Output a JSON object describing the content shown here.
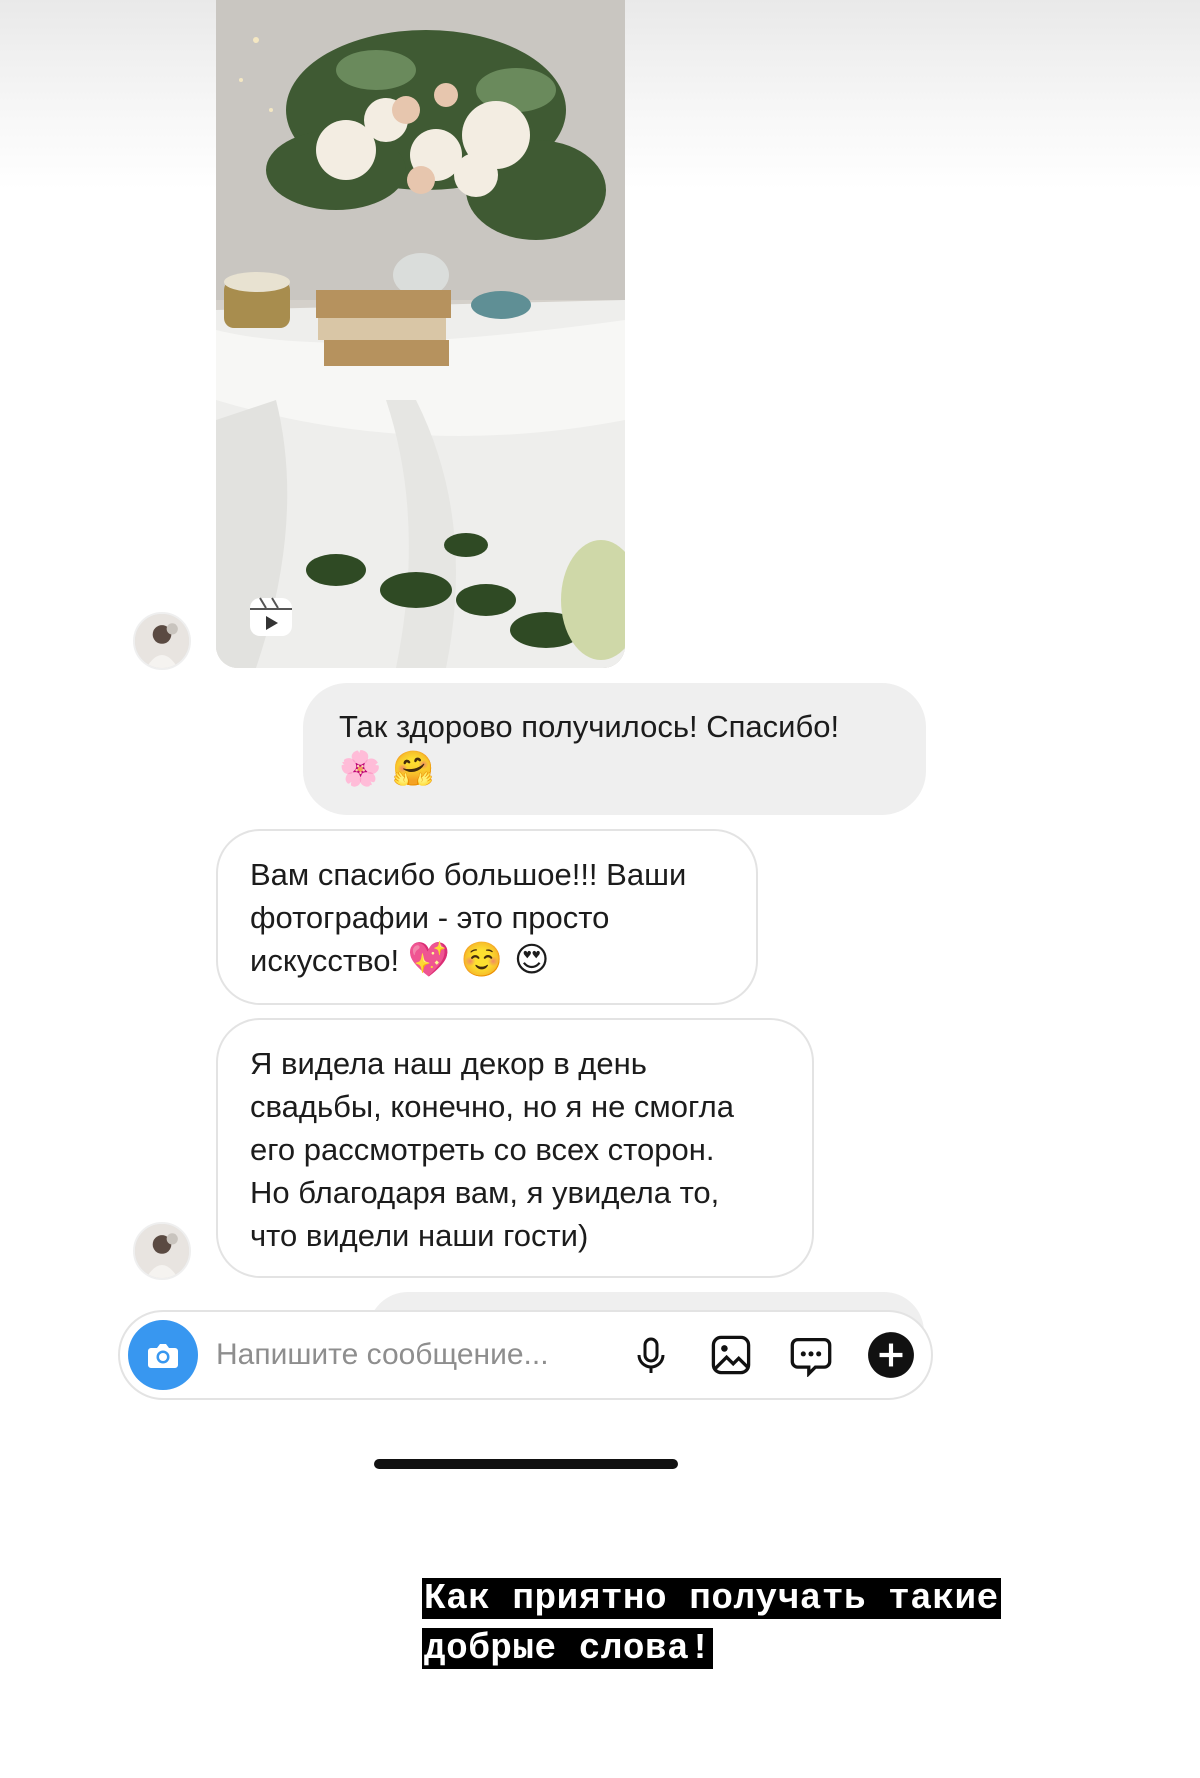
{
  "conversation": {
    "messages": [
      {
        "direction": "out",
        "text": "Так здорово получилось! Спасибо!",
        "emoji": "🌸 🤗"
      },
      {
        "direction": "in",
        "lines": [
          "Вам спасибо большое!!! Ваши",
          "фотографии - это просто",
          "искусство!"
        ],
        "emoji": "💖 ☺️ 😍"
      },
      {
        "direction": "in",
        "lines": [
          "Я видела наш декор в день",
          "свадьбы, конечно, но я не смогла",
          "его рассмотреть со всех сторон.",
          "Но благодаря вам, я увидела то,",
          "что видели наши гости)"
        ]
      }
    ],
    "shared_media": {
      "type": "reel",
      "icon": "reels-icon"
    }
  },
  "composer": {
    "placeholder": "Напишите сообщение...",
    "icons": [
      "camera-icon",
      "microphone-icon",
      "gallery-icon",
      "sticker-icon",
      "plus-icon"
    ]
  },
  "story_caption": {
    "line1": "Как приятно получать такие",
    "line2": "добрые слова!"
  },
  "colors": {
    "accent": "#3897f0",
    "outgoing_bubble": "#efefef",
    "incoming_border": "#e3e3e3",
    "caption_bg": "#000000",
    "caption_text": "#ffffff"
  }
}
